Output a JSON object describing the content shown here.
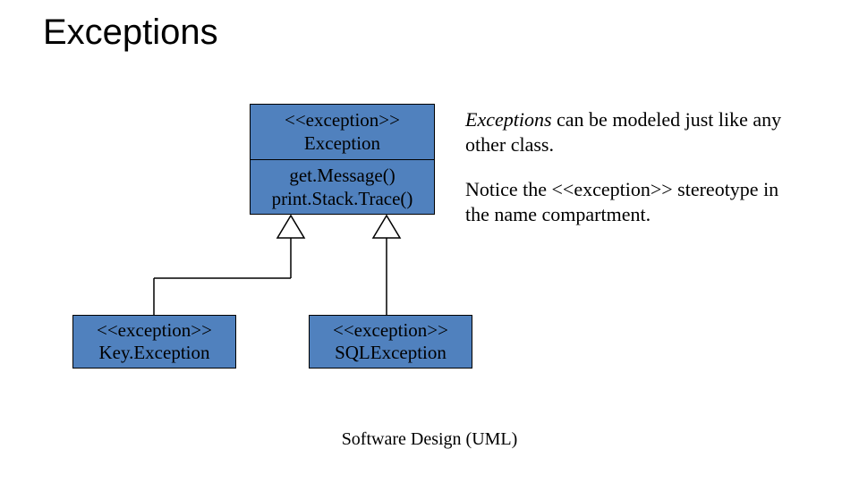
{
  "title": "Exceptions",
  "parent": {
    "stereotype": "<<exception>>",
    "name": "Exception",
    "op1": "get.Message()",
    "op2": "print.Stack.Trace()"
  },
  "child_left": {
    "stereotype": "<<exception>>",
    "name": "Key.Exception"
  },
  "child_right": {
    "stereotype": "<<exception>>",
    "name": "SQLException"
  },
  "note1_italic": "Exceptions",
  "note1_rest": " can be modeled just like any other class.",
  "note2": "Notice the <<exception>> stereotype in the name compartment.",
  "footer": "Software Design (UML)"
}
